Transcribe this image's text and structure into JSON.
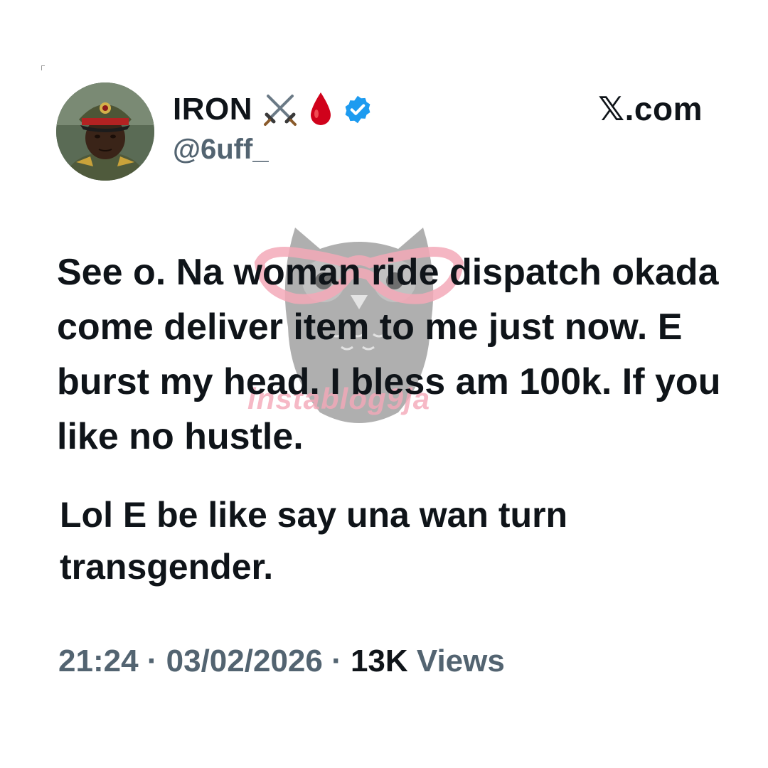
{
  "header": {
    "display_name": "IRON",
    "handle": "@6uff_",
    "brand": "𝕏.com"
  },
  "icons": {
    "name_emoji_1": "crossed-swords-icon",
    "name_emoji_2": "blood-drop-icon",
    "verified": "verified-badge-icon",
    "verified_color": "#1d9bf0"
  },
  "watermark": {
    "text": "instablog9ja"
  },
  "tweet": {
    "text": "See o. Na woman ride dispatch okada come deliver item to me just now. E burst my head. I bless am 100k. If you like no hustle.",
    "reply_text": "Lol E be like say una wan turn transgender."
  },
  "meta": {
    "time_date": "21:24 · 03/02/2026 · ",
    "views_count": "13K",
    "views_label": " Views"
  }
}
